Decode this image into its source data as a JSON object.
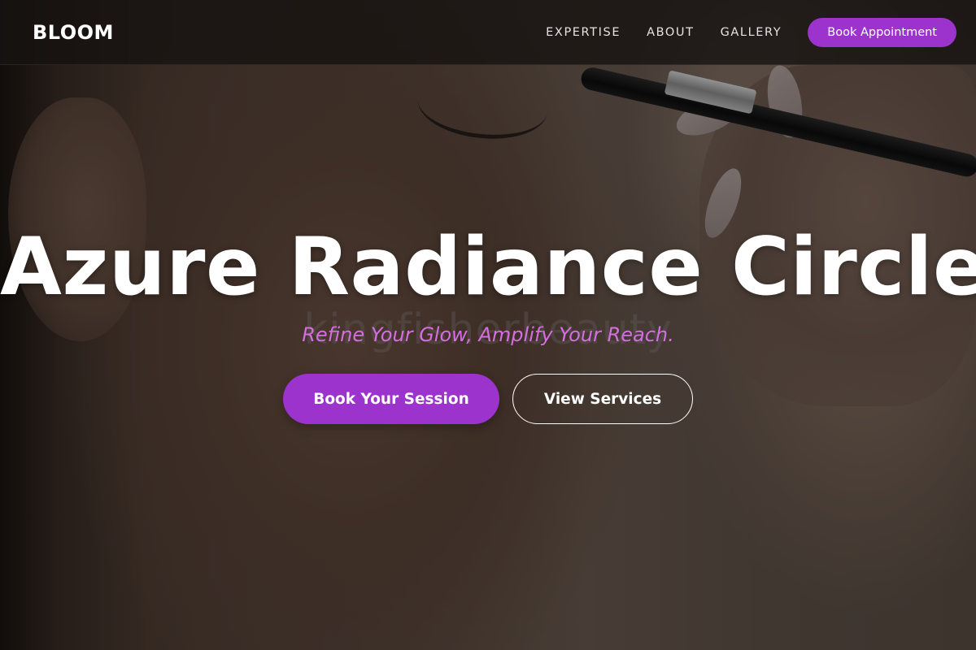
{
  "navbar": {
    "brand": "BLOOM",
    "links": [
      "EXPERTISE",
      "ABOUT",
      "GALLERY"
    ],
    "cta_label": "Book Appointment"
  },
  "hero": {
    "title": "Azure Radiance Circle",
    "watermark": "kingfisherbeauty",
    "subtitle": "Refine Your Glow, Amplify Your Reach.",
    "primary_button": "Book Your Session",
    "secondary_button": "View Services"
  },
  "colors": {
    "accent": "#9b33cc",
    "subtitle": "#d56ee0",
    "navbar_bg": "#141110",
    "text": "#ffffff"
  }
}
